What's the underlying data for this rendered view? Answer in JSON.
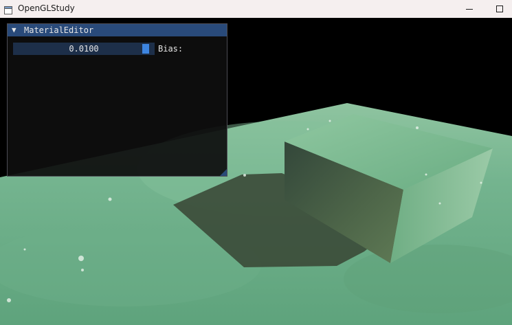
{
  "window": {
    "title": "OpenGLStudy",
    "minimize_glyph": "—",
    "maximize_glyph": "☐"
  },
  "material_editor": {
    "title": "MaterialEditor",
    "collapse_glyph": "▼",
    "bias": {
      "label": "Bias:",
      "value_text": "0.0100",
      "value": 0.01,
      "handle_position": 0.97
    }
  },
  "colors": {
    "imgui_title": "#294a7a",
    "imgui_bg": "#0e0e0e",
    "slider_frame": "#1d2f49",
    "slider_grab": "#3d85e0",
    "ground": "#6fae8a",
    "cube_side": "#3f5a43",
    "shadow": "#3a4a37"
  },
  "icons": {
    "app": "window-app-icon"
  }
}
